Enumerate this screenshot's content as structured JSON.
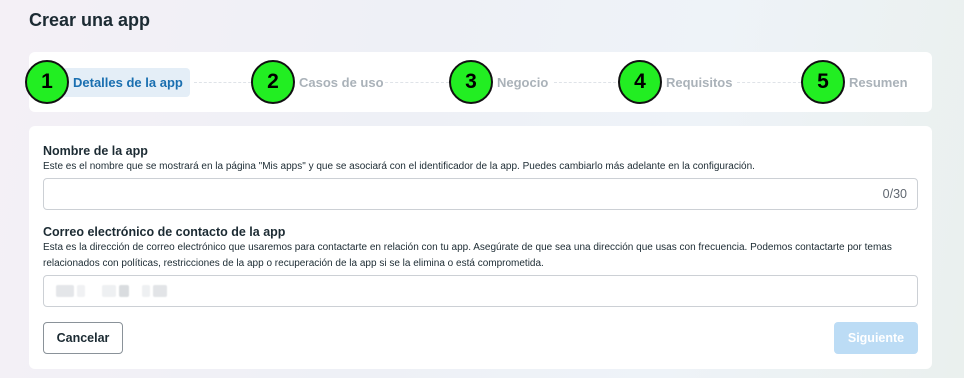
{
  "page": {
    "title": "Crear una app"
  },
  "stepper": {
    "steps": [
      {
        "number": "1",
        "label": "Detalles de la app",
        "active": true
      },
      {
        "number": "2",
        "label": "Casos de uso",
        "active": false
      },
      {
        "number": "3",
        "label": "Negocio",
        "active": false
      },
      {
        "number": "4",
        "label": "Requisitos",
        "active": false
      },
      {
        "number": "5",
        "label": "Resumen",
        "active": false
      }
    ]
  },
  "form": {
    "app_name": {
      "label": "Nombre de la app",
      "description": "Este es el nombre que se mostrará en la página \"Mis apps\" y que se asociará con el identificador de la app. Puedes cambiarlo más adelante en la configuración.",
      "value": "",
      "counter": "0/30"
    },
    "contact_email": {
      "label": "Correo electrónico de contacto de la app",
      "description": "Esta es la dirección de correo electrónico que usaremos para contactarte en relación con tu app. Asegúrate de que sea una dirección que usas con frecuencia. Podemos contactarte por temas relacionados con políticas, restricciones de la app o recuperación de la app si se la elimina o está comprometida.",
      "value_redacted": true
    }
  },
  "actions": {
    "cancel_label": "Cancelar",
    "next_label": "Siguiente",
    "next_enabled": false
  },
  "colors": {
    "step_badge": "#22ee22",
    "active_step_text": "#1a6fb0",
    "active_step_bg": "#e4eef7",
    "inactive_step_text": "#aab2b9",
    "disabled_primary": "#bcdcf5"
  }
}
